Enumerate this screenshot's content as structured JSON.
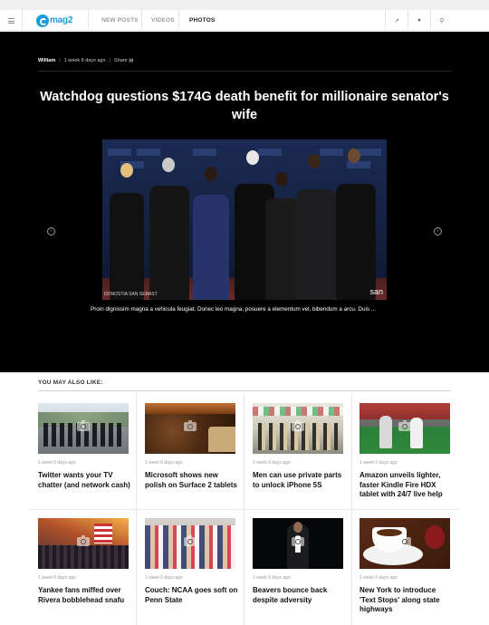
{
  "brand": {
    "logo_text": "mag2",
    "accent": "#1a9cd8"
  },
  "nav": {
    "links": [
      {
        "label": "NEW POSTS"
      },
      {
        "label": "VIDEOS"
      },
      {
        "label": "PHOTOS",
        "active": true
      }
    ],
    "icons": [
      "menu-icon",
      "share-icon",
      "user-icon",
      "search-icon"
    ]
  },
  "article": {
    "author": "William",
    "time": "1 week 6 days ago",
    "share_label": "Share",
    "headline": "Watchdog questions $174G death benefit for millionaire senator's wife",
    "photo_watermark": "san",
    "photo_corner_text": "DONOSTIA SAN SEBAST",
    "caption": "Proin dignissim magna a vehicula feugiat. Donec leo magna, posuere a elementum vel, bibendum a arcu. Duis     ..."
  },
  "related": {
    "title": "YOU MAY ALSO LIKE:",
    "cards": [
      {
        "time": "1 week 6 days ago",
        "title": "Twitter wants your TV chatter (and network cash)"
      },
      {
        "time": "1 week 6 days ago",
        "title": "Microsoft shows new polish on Surface 2 tablets"
      },
      {
        "time": "1 week 6 days ago",
        "title": "Men can use private parts to unlock iPhone 5S"
      },
      {
        "time": "1 week 6 days ago",
        "title": "Amazon unveils lighter, faster Kindle Fire HDX tablet with 24/7 live help"
      },
      {
        "time": "1 week 6 days ago",
        "title": "Yankee fans miffed over Rivera bobblehead snafu"
      },
      {
        "time": "1 week 6 days ago",
        "title": "Couch: NCAA goes soft on Penn State"
      },
      {
        "time": "1 week 6 days ago",
        "title": "Beavers bounce back despite adversity"
      },
      {
        "time": "1 week 6 days ago",
        "title": "New York to introduce 'Text Stops' along state highways"
      }
    ]
  }
}
